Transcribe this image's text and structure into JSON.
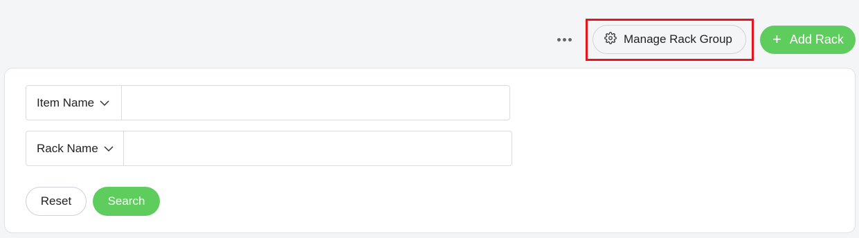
{
  "toolbar": {
    "more_icon": "more-horizontal-icon",
    "manage_rack_group": {
      "label": "Manage Rack Group",
      "icon": "gear-icon"
    },
    "add_rack": {
      "label": "Add Rack",
      "icon": "plus-icon"
    },
    "highlight_color": "#e8141b"
  },
  "filters": {
    "rows": [
      {
        "field_label": "Item Name",
        "value": "",
        "placeholder": ""
      },
      {
        "field_label": "Rack Name",
        "value": "",
        "placeholder": ""
      }
    ],
    "reset_label": "Reset",
    "search_label": "Search"
  },
  "colors": {
    "accent": "#5fcc5e",
    "background": "#f4f5f7",
    "panel": "#ffffff"
  }
}
